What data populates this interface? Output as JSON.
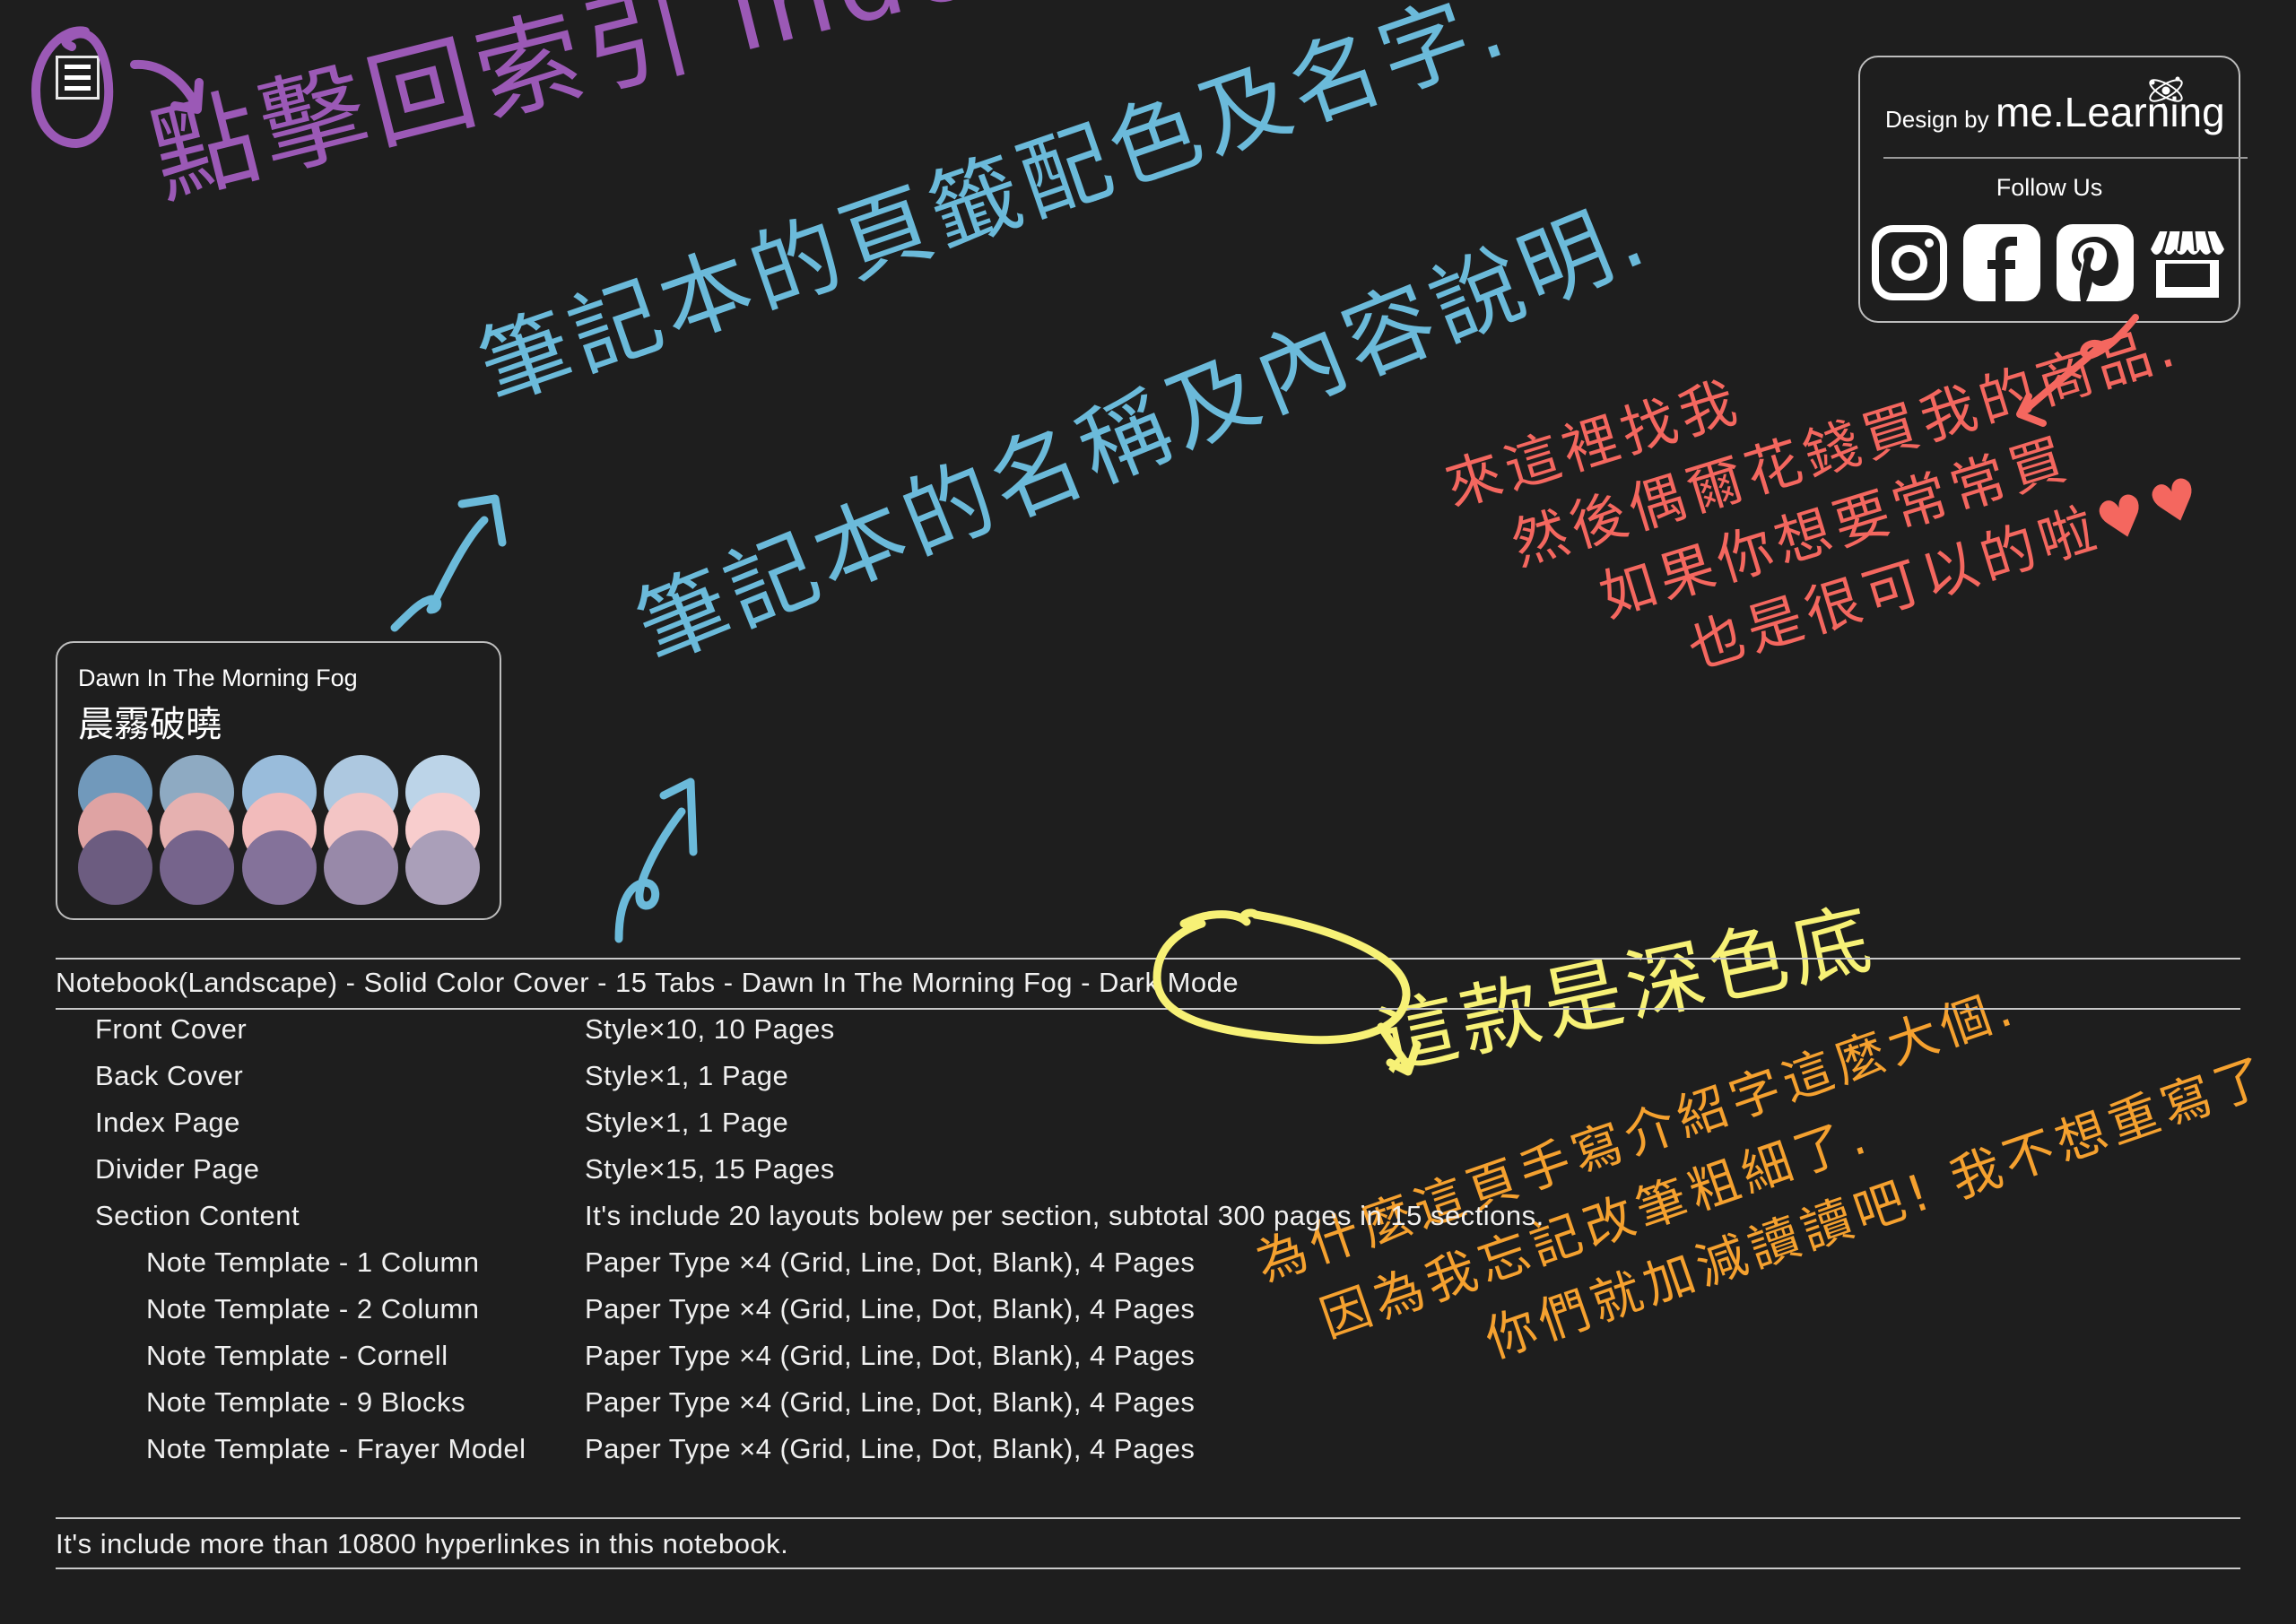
{
  "menu": {
    "icon": "hamburger-menu-icon"
  },
  "annotations": {
    "index_hint": "點擊回索引 index",
    "tabs_hint": "筆記本的頁籤配色及名字.",
    "name_hint": "筆記本的名稱及內容說明.",
    "follow_hint": "來這裡找我\n  然後偶爾花錢買我的商品.\n     如果你想要常常買\n        也是很可以的啦♥♥",
    "dark_hint": "這款是深色底",
    "why_hint": "為什麼這頁手寫介紹字這麼大個.\n  因為我忘記改筆粗細了.\n         你們就加減讀讀吧! 我不想重寫了"
  },
  "brand": {
    "design_by": "Design by",
    "name": "me.Learning",
    "follow_us": "Follow Us",
    "social": [
      {
        "name": "instagram",
        "icon": "instagram-icon"
      },
      {
        "name": "facebook",
        "icon": "facebook-icon"
      },
      {
        "name": "pinterest",
        "icon": "pinterest-icon"
      },
      {
        "name": "shop",
        "icon": "storefront-icon"
      }
    ]
  },
  "palette": {
    "name_en": "Dawn In The Morning Fog",
    "name_zh": "晨霧破曉",
    "rows": [
      [
        "#7199bb",
        "#8eaac2",
        "#99bcdb",
        "#adc8e0",
        "#bcd4e8"
      ],
      [
        "#dfa3a3",
        "#e6b1b0",
        "#f2bbbb",
        "#f3c5c5",
        "#f8cdcd"
      ],
      [
        "#6c5c80",
        "#76648c",
        "#84729a",
        "#9889a9",
        "#aa9fb9"
      ]
    ]
  },
  "notebook": {
    "title": "Notebook(Landscape) - Solid Color Cover - 15 Tabs - Dawn In The Morning Fog - Dark Mode",
    "rows": [
      {
        "label": "Front Cover",
        "value": "Style×10, 10 Pages",
        "sub": false
      },
      {
        "label": "Back Cover",
        "value": "Style×1, 1 Page",
        "sub": false
      },
      {
        "label": "Index Page",
        "value": "Style×1, 1 Page",
        "sub": false
      },
      {
        "label": "Divider Page",
        "value": "Style×15, 15 Pages",
        "sub": false
      },
      {
        "label": "Section Content",
        "value": "It's include 20 layouts bolew per section, subtotal 300 pages in 15 sections.",
        "sub": false
      },
      {
        "label": "Note Template - 1 Column",
        "value": "Paper Type ×4 (Grid, Line, Dot, Blank), 4 Pages",
        "sub": true
      },
      {
        "label": "Note Template - 2 Column",
        "value": "Paper Type ×4 (Grid, Line, Dot, Blank), 4 Pages",
        "sub": true
      },
      {
        "label": "Note Template - Cornell",
        "value": "Paper Type ×4 (Grid, Line, Dot, Blank), 4 Pages",
        "sub": true
      },
      {
        "label": "Note Template - 9 Blocks",
        "value": "Paper Type ×4 (Grid, Line, Dot, Blank), 4 Pages",
        "sub": true
      },
      {
        "label": "Note Template - Frayer Model",
        "value": "Paper Type ×4 (Grid, Line, Dot, Blank), 4 Pages",
        "sub": true
      }
    ],
    "footer": "It's include more than 10800 hyperlinkes in this notebook."
  },
  "colors": {
    "background": "#1e1e1e",
    "purple": "#9b59b6",
    "blue": "#6bbada",
    "coral": "#f4675f",
    "yellow": "#f7f176",
    "orange": "#f5a12f"
  }
}
